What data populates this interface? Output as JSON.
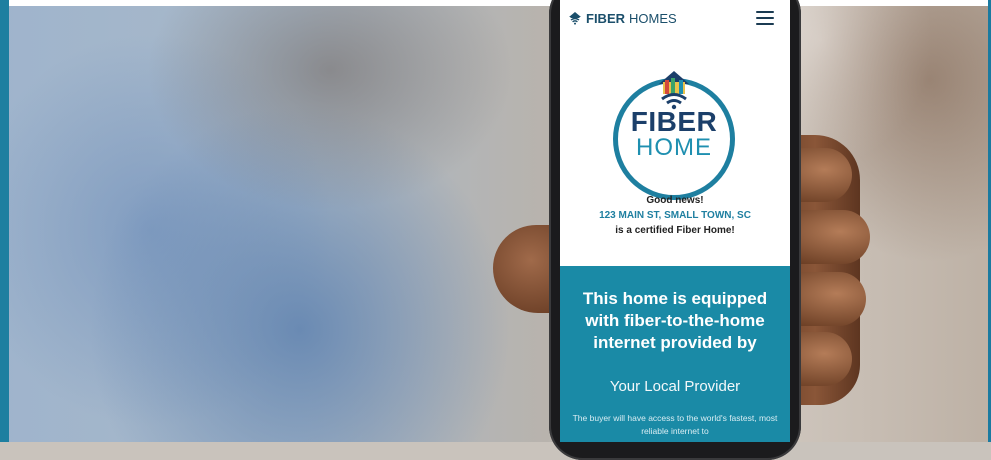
{
  "nav": {
    "brand_bold": "FIBER",
    "brand_light": "HOMES",
    "brand_icon": "wifi-house-icon",
    "menu_icon": "hamburger-menu-icon"
  },
  "logo": {
    "line1": "FIBER",
    "line2": "HOME",
    "icon": "house-wifi-icon"
  },
  "status": {
    "greeting": "Good news!",
    "address": "123 MAIN ST, SMALL TOWN, SC",
    "certified": "is a certified Fiber Home!"
  },
  "banner": {
    "headline": "This home is equipped with fiber-to-the-home internet provided by",
    "provider": "Your Local Provider",
    "body": "The buyer will have access to the world's fastest, most reliable internet to"
  },
  "colors": {
    "accent": "#1a8aa6",
    "navy": "#1b3f6a",
    "light_blue": "#1e8fb0"
  }
}
